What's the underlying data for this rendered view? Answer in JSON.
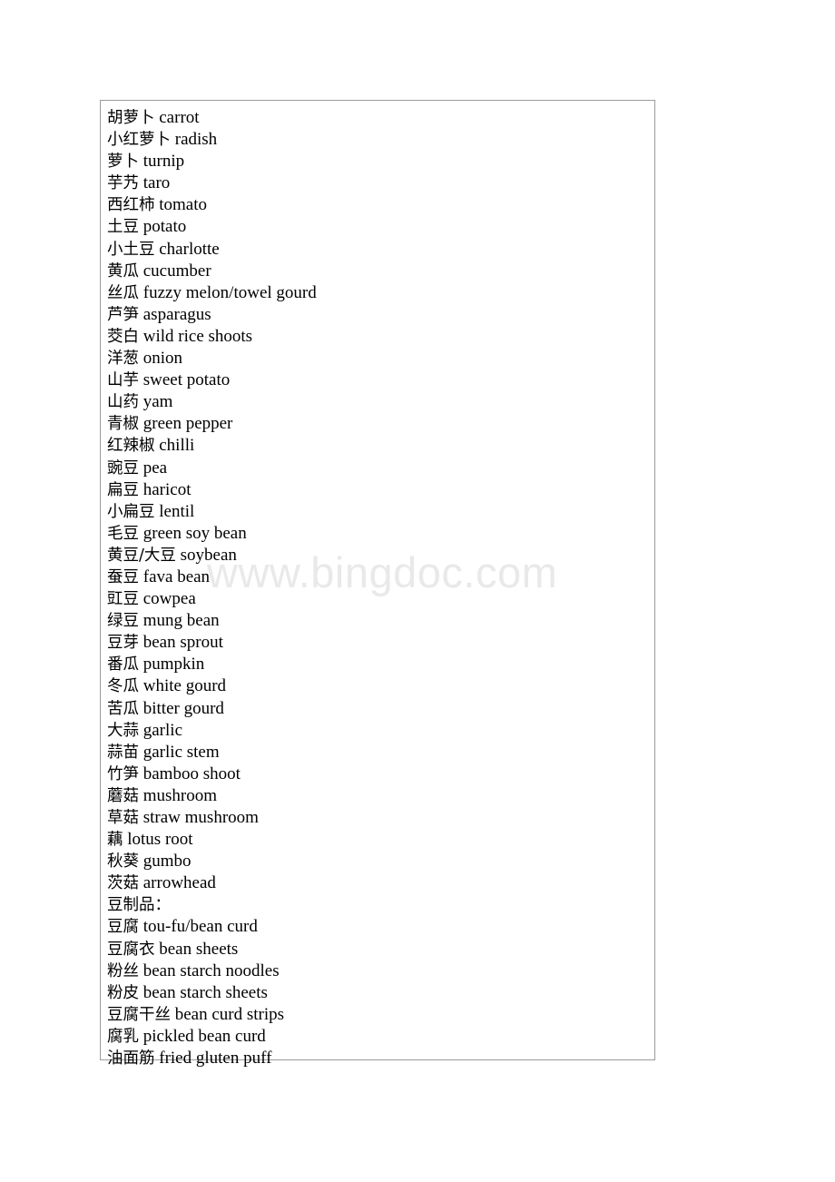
{
  "document": {
    "watermark": "www.bingdoc.com",
    "border_color": "#9b9b9b",
    "text_color": "#000000",
    "watermark_color": "#e9e9e9",
    "background_color": "#ffffff"
  },
  "vocab": {
    "entries": [
      {
        "zh": "胡萝卜",
        "en": "carrot"
      },
      {
        "zh": "小红萝卜",
        "en": "radish"
      },
      {
        "zh": "萝卜",
        "en": "turnip"
      },
      {
        "zh": "芋艿",
        "en": "taro"
      },
      {
        "zh": "西红柿",
        "en": "tomato"
      },
      {
        "zh": "土豆",
        "en": "potato"
      },
      {
        "zh": "小土豆",
        "en": "charlotte"
      },
      {
        "zh": "黄瓜",
        "en": "cucumber"
      },
      {
        "zh": "丝瓜",
        "en": "fuzzy melon/towel gourd"
      },
      {
        "zh": "芦笋",
        "en": "asparagus"
      },
      {
        "zh": "茭白",
        "en": "wild rice shoots"
      },
      {
        "zh": "洋葱",
        "en": "onion"
      },
      {
        "zh": "山芋",
        "en": "sweet potato"
      },
      {
        "zh": "山药",
        "en": "yam"
      },
      {
        "zh": "青椒",
        "en": "green pepper"
      },
      {
        "zh": "红辣椒",
        "en": "chilli"
      },
      {
        "zh": "豌豆",
        "en": "pea"
      },
      {
        "zh": "扁豆",
        "en": "haricot"
      },
      {
        "zh": "小扁豆",
        "en": "lentil"
      },
      {
        "zh": "毛豆",
        "en": "green soy bean"
      },
      {
        "zh": "黄豆/大豆",
        "en": "soybean"
      },
      {
        "zh": "蚕豆",
        "en": "fava bean"
      },
      {
        "zh": "豇豆",
        "en": "cowpea"
      },
      {
        "zh": "绿豆",
        "en": "mung bean"
      },
      {
        "zh": "豆芽",
        "en": "bean sprout"
      },
      {
        "zh": "番瓜",
        "en": "pumpkin"
      },
      {
        "zh": "冬瓜",
        "en": "white gourd"
      },
      {
        "zh": "苦瓜",
        "en": "bitter gourd"
      },
      {
        "zh": "大蒜",
        "en": "garlic"
      },
      {
        "zh": "蒜苗",
        "en": "garlic stem"
      },
      {
        "zh": "竹笋",
        "en": "bamboo shoot"
      },
      {
        "zh": "蘑菇",
        "en": "mushroom"
      },
      {
        "zh": "草菇",
        "en": "straw mushroom"
      },
      {
        "zh": "藕",
        "en": "lotus root"
      },
      {
        "zh": "秋葵",
        "en": "gumbo"
      },
      {
        "zh": "茨菇",
        "en": "arrowhead"
      },
      {
        "zh": "豆制品：",
        "en": ""
      },
      {
        "zh": "豆腐",
        "en": "tou-fu/bean curd"
      },
      {
        "zh": "豆腐衣",
        "en": "bean sheets"
      },
      {
        "zh": "粉丝",
        "en": "bean starch noodles"
      },
      {
        "zh": "粉皮",
        "en": "bean starch sheets"
      },
      {
        "zh": "豆腐干丝",
        "en": "bean curd strips"
      },
      {
        "zh": "腐乳",
        "en": "pickled bean curd"
      },
      {
        "zh": "油面筋",
        "en": "fried gluten puff"
      }
    ]
  }
}
